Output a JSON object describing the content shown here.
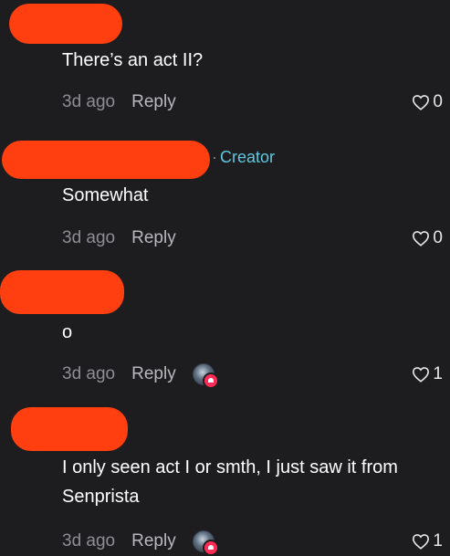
{
  "comments": [
    {
      "text": "There’s an act II?",
      "time": "3d ago",
      "reply": "Reply",
      "likes": "0"
    },
    {
      "creator_label": "Creator",
      "creator_sep": "·",
      "text": "Somewhat",
      "time": "3d ago",
      "reply": "Reply",
      "likes": "0"
    },
    {
      "text": "o",
      "time": "3d ago",
      "reply": "Reply",
      "likes": "1"
    },
    {
      "text": "I only seen act I or smth, I just saw it from Senprista",
      "time": "3d ago",
      "reply": "Reply",
      "likes": "1"
    }
  ],
  "colors": {
    "background": "#1d1d1f",
    "redaction": "#ff3f0f",
    "creator": "#5fc8e0",
    "muted": "#8e8e93"
  },
  "icons": {
    "like": "heart-outline-icon",
    "author_liked": "author-avatar-liked-badge-icon"
  }
}
